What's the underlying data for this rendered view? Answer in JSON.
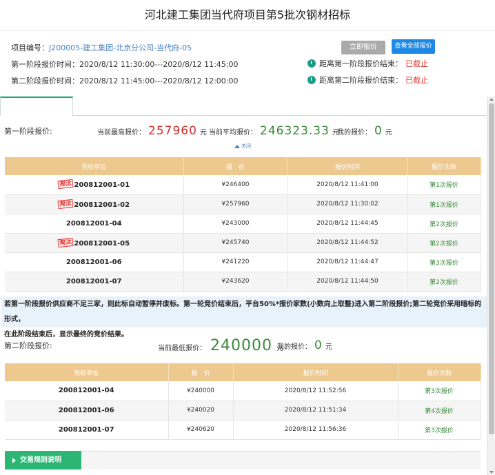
{
  "title": "河北建工集团当代府项目第5批次钢材招标",
  "project": {
    "code_label": "项目编号：",
    "code_value": "J200005-建工集团-北京分公司-当代府-05",
    "stage1_time_label": "第一阶段报价时间：",
    "stage1_time_value": "2020/8/12 11:30:00---2020/8/12 11:45:00",
    "stage2_time_label": "第二阶段报价时间：",
    "stage2_time_value": "2020/8/12 11:45:00---2020/8/12 12:00:00"
  },
  "buttons": {
    "quote_now": "立即报价",
    "view_all_quotes": "查看全部报价"
  },
  "countdowns": [
    {
      "label": "距离第一阶段报价结束：",
      "status": "已截止"
    },
    {
      "label": "距离第二阶段报价结束：",
      "status": "已截止"
    }
  ],
  "stage1": {
    "label": "第一阶段报价:",
    "highest_label": "当前最高报价：",
    "highest_value": "257960",
    "avg_label": "当前平均报价：",
    "avg_value": "246323.33",
    "mine_label": "我的报价：",
    "mine_value": "0",
    "unit": "元",
    "collapse_label": "关闭",
    "headers": [
      "竞标单位",
      "报　价",
      "报价时间",
      "报价次数"
    ],
    "rows": [
      {
        "eliminated": true,
        "unit": "200812001-01",
        "price": "¥246400",
        "time": "2020/8/12 11:41:00",
        "count": "第1次报价"
      },
      {
        "eliminated": true,
        "unit": "200812001-02",
        "price": "¥257960",
        "time": "2020/8/12 11:30:02",
        "count": "第1次报价"
      },
      {
        "eliminated": false,
        "unit": "200812001-04",
        "price": "¥243000",
        "time": "2020/8/12 11:44:45",
        "count": "第2次报价"
      },
      {
        "eliminated": true,
        "unit": "200812001-05",
        "price": "¥245740",
        "time": "2020/8/12 11:44:52",
        "count": "第2次报价"
      },
      {
        "eliminated": false,
        "unit": "200812001-06",
        "price": "¥241220",
        "time": "2020/8/12 11:44:47",
        "count": "第3次报价"
      },
      {
        "eliminated": false,
        "unit": "200812001-07",
        "price": "¥243620",
        "time": "2020/8/12 11:44:50",
        "count": "第2次报价"
      }
    ],
    "eliminated_badge": "淘汰"
  },
  "rules_note": {
    "line1": "若第一阶段报价供应商不足三家，则此标自动暂停并废标。第一轮竞价结束后，平台50%*报价家数(小数向上取整)进入第二阶段报价;第二轮竞价采用暗标的形式，",
    "line2": "在此阶段结束后，显示最终的竞价结果。"
  },
  "stage2": {
    "label": "第二阶段报价:",
    "lowest_label": "当前最低报价：",
    "lowest_value": "240000",
    "mine_label": "我的报价：",
    "mine_value": "0",
    "unit": "元",
    "headers": [
      "竞标单位",
      "报　价",
      "报价时间",
      "报价次数"
    ],
    "rows": [
      {
        "unit": "200812001-04",
        "price": "¥240000",
        "time": "2020/8/12 11:52:56",
        "count": "第3次报价"
      },
      {
        "unit": "200812001-06",
        "price": "¥240020",
        "time": "2020/8/12 11:51:34",
        "count": "第4次报价"
      },
      {
        "unit": "200812001-07",
        "price": "¥240620",
        "time": "2020/8/12 11:56:36",
        "count": "第3次报价"
      }
    ]
  },
  "footer": {
    "rules_button": "交易规则说明"
  },
  "colors": {
    "accent_green": "#2bb673",
    "header_tan": "#edc98f",
    "primary_blue": "#1e88e5",
    "alert_red": "#e53935"
  }
}
